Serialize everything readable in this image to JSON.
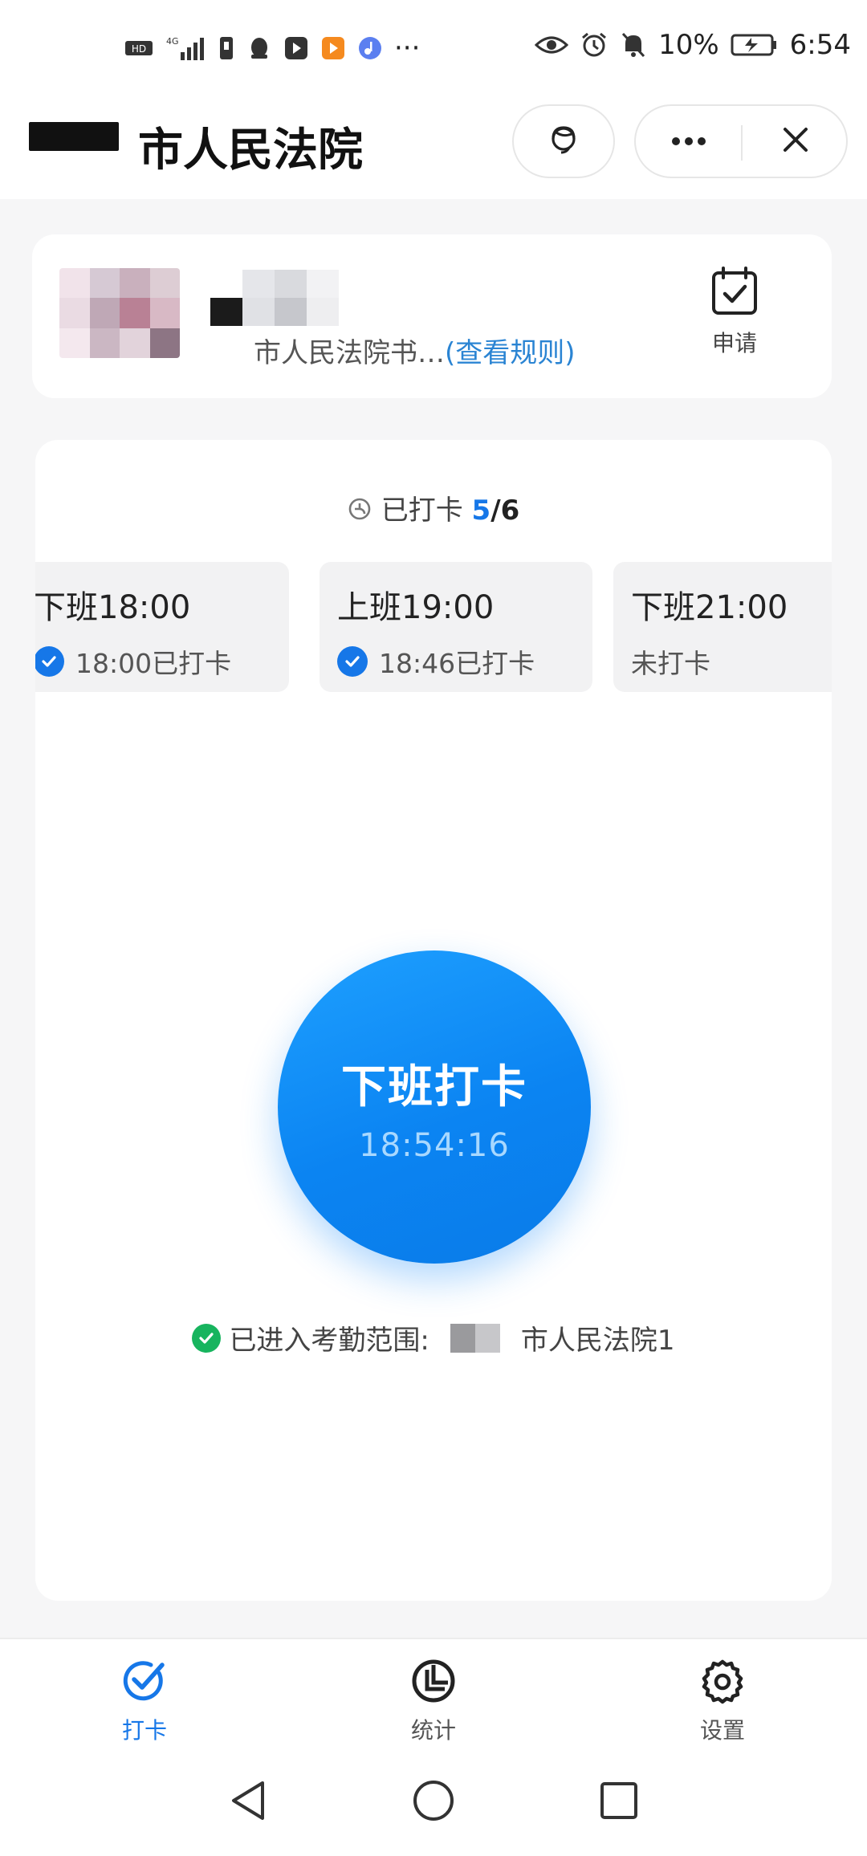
{
  "status_bar": {
    "battery_percent": "10%",
    "time": "6:54",
    "network": "4G",
    "more": "···"
  },
  "header": {
    "title": "市人民法院",
    "support_icon": "headset-icon",
    "more_icon": "more-dots-icon",
    "close_icon": "close-icon"
  },
  "profile": {
    "rule_text": "市人民法院书…",
    "rule_link": "(查看规则)",
    "apply_label": "申请"
  },
  "progress": {
    "prefix": "已打卡",
    "done": "5",
    "total": "/6"
  },
  "shifts": [
    {
      "title": "下班18:00",
      "status": "18:00已打卡",
      "checked": true
    },
    {
      "title": "上班19:00",
      "status": "18:46已打卡",
      "checked": true
    },
    {
      "title": "下班21:00",
      "status": "未打卡",
      "checked": false
    }
  ],
  "punch_button": {
    "label": "下班打卡",
    "time": "18:54:16"
  },
  "range": {
    "text": "已进入考勤范围:",
    "location": "市人民法院1"
  },
  "tabs": [
    {
      "label": "打卡",
      "icon": "check-badge-icon",
      "active": true
    },
    {
      "label": "统计",
      "icon": "pie-chart-icon",
      "active": false
    },
    {
      "label": "设置",
      "icon": "gear-icon",
      "active": false
    }
  ],
  "colors": {
    "accent": "#1677e8",
    "success": "#17b45e",
    "card": "#ffffff",
    "background": "#f6f6f7"
  }
}
